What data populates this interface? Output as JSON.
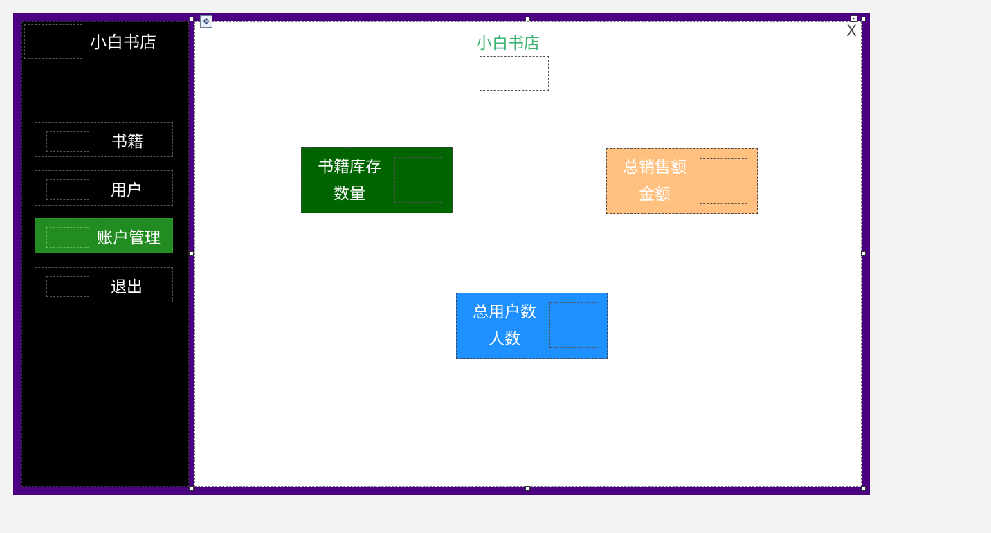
{
  "sidebar": {
    "brand": "小白书店",
    "items": [
      {
        "label": "书籍",
        "active": false
      },
      {
        "label": "用户",
        "active": false
      },
      {
        "label": "账户管理",
        "active": true
      },
      {
        "label": "退出",
        "active": false
      }
    ]
  },
  "main": {
    "title": "小白书店",
    "close_label": "X",
    "cards": {
      "books": {
        "line1": "书籍库存",
        "line2": "数量",
        "color": "#006400"
      },
      "sales": {
        "line1": "总销售额",
        "line2": "金额",
        "color": "#ffc080"
      },
      "users": {
        "line1": "总用户数",
        "line2": "人数",
        "color": "#1e90ff"
      }
    }
  },
  "colors": {
    "form_border": "#4b0082",
    "sidebar_bg": "#000000",
    "active_nav": "#228b22",
    "title_color": "#3cb371"
  },
  "icons": {
    "move": "move-arrows-icon",
    "smart_tag": "smart-tag-icon"
  }
}
